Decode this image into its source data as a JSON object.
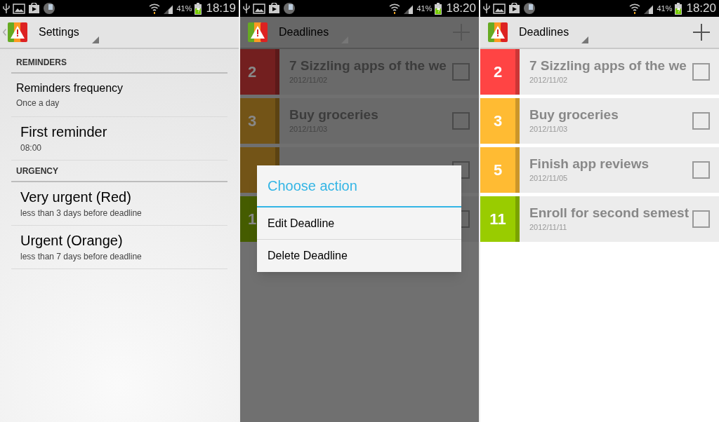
{
  "screens": [
    {
      "kind": "settings",
      "status_bar": {
        "battery": "41%",
        "time": "18:19"
      },
      "action_bar": {
        "title": "Settings",
        "back": true,
        "add": false
      },
      "sections": [
        {
          "header": "REMINDERS",
          "items": [
            {
              "title": "Reminders frequency",
              "summary": "Once a day",
              "kind": "compact"
            },
            {
              "title": "First reminder",
              "summary": "08:00",
              "kind": "large"
            }
          ]
        },
        {
          "header": "URGENCY",
          "items": [
            {
              "title": "Very urgent (Red)",
              "summary": "less than 3 days before deadline",
              "kind": "large"
            },
            {
              "title": "Urgent (Orange)",
              "summary": "less than 7 days before deadline",
              "kind": "large"
            }
          ]
        }
      ]
    },
    {
      "kind": "list",
      "status_bar": {
        "battery": "41%",
        "time": "18:20"
      },
      "action_bar": {
        "title": "Deadlines",
        "back": false,
        "add": true
      },
      "deadlines": [
        {
          "days": "2",
          "title": "7 Sizzling apps of the we",
          "date": "2012/11/02",
          "color": "#731f1f",
          "checked": false
        },
        {
          "days": "3",
          "title": "Buy groceries",
          "date": "2012/11/03",
          "color": "#735417",
          "checked": false
        },
        {
          "color": "#735417",
          "checked": false
        },
        {
          "days": "1",
          "color": "#455c00",
          "checked": false
        }
      ],
      "dialog": {
        "title": "Choose action",
        "options": [
          "Edit Deadline",
          "Delete Deadline"
        ]
      }
    },
    {
      "kind": "list",
      "status_bar": {
        "battery": "41%",
        "time": "18:20"
      },
      "action_bar": {
        "title": "Deadlines",
        "back": false,
        "add": true
      },
      "deadlines": [
        {
          "days": "2",
          "title": "7 Sizzling apps of the we",
          "date": "2012/11/02",
          "color": "#ff4444",
          "checked": false
        },
        {
          "days": "3",
          "title": "Buy groceries",
          "date": "2012/11/03",
          "color": "#ffbb33",
          "checked": false
        },
        {
          "days": "5",
          "title": "Finish app reviews",
          "date": "2012/11/05",
          "color": "#ffbb33",
          "checked": false
        },
        {
          "days": "11",
          "title": "Enroll for second semest",
          "date": "2012/11/11",
          "color": "#99cc00",
          "checked": false
        }
      ]
    }
  ]
}
